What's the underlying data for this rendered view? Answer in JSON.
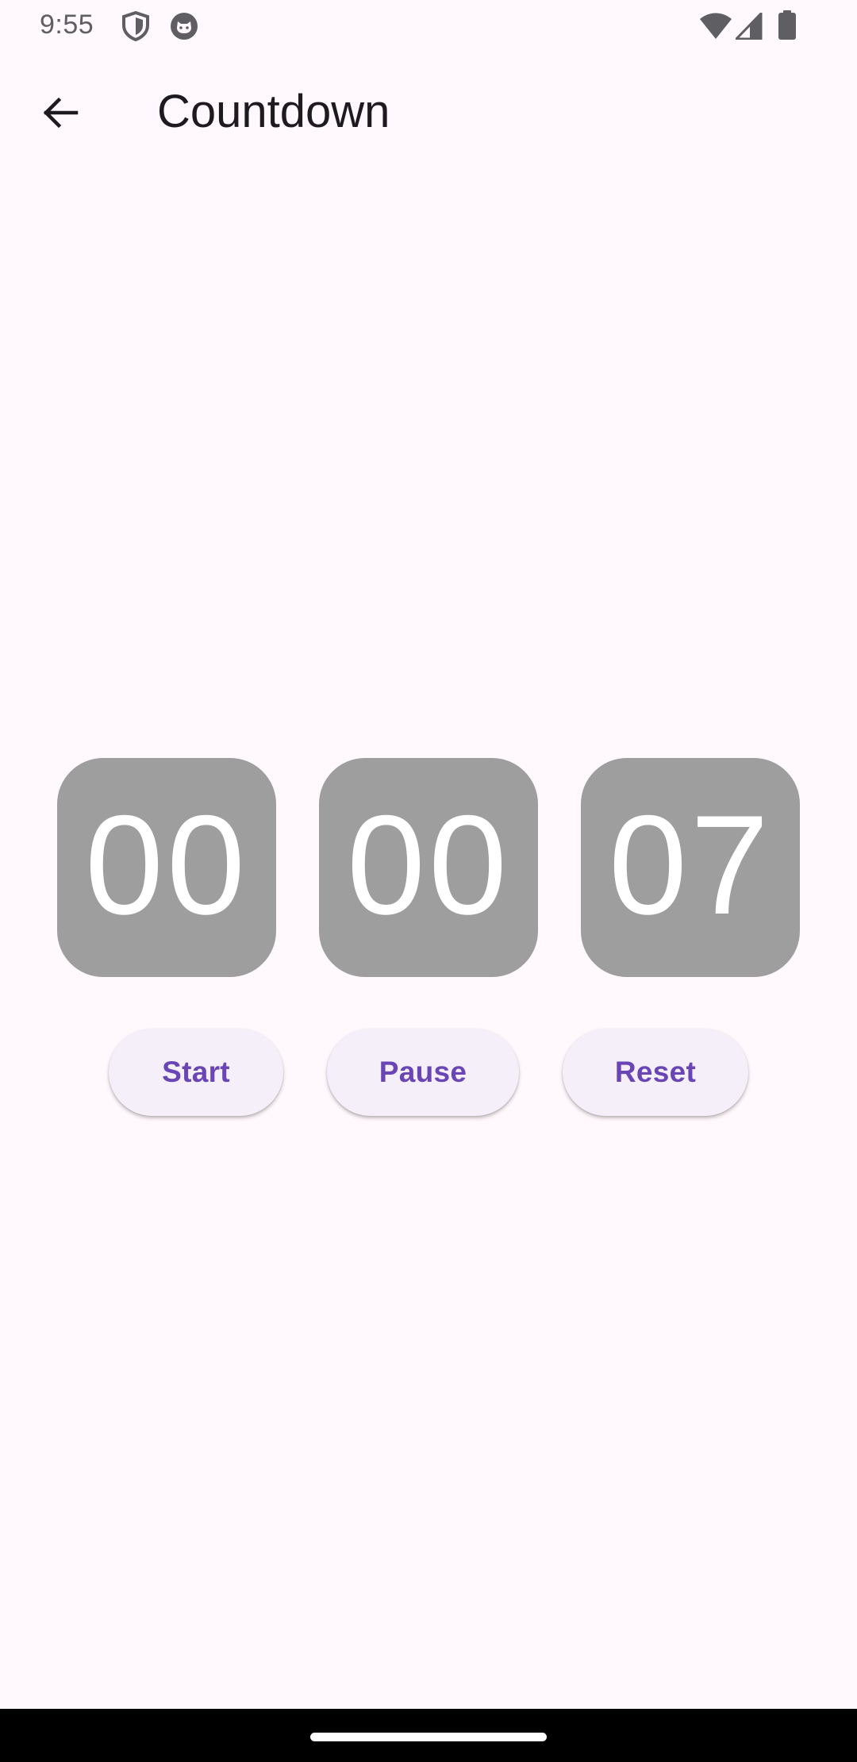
{
  "status_bar": {
    "time": "9:55",
    "icons": [
      "shield-icon",
      "cat-face-icon",
      "wifi-icon",
      "cellular-signal-icon",
      "battery-icon"
    ]
  },
  "app_bar": {
    "title": "Countdown",
    "back_icon": "arrow-back-icon"
  },
  "timer": {
    "hours": "00",
    "minutes": "00",
    "seconds": "07",
    "box_color": "#9E9E9E"
  },
  "controls": {
    "start_label": "Start",
    "pause_label": "Pause",
    "reset_label": "Reset",
    "accent_color": "#6A45B5"
  }
}
